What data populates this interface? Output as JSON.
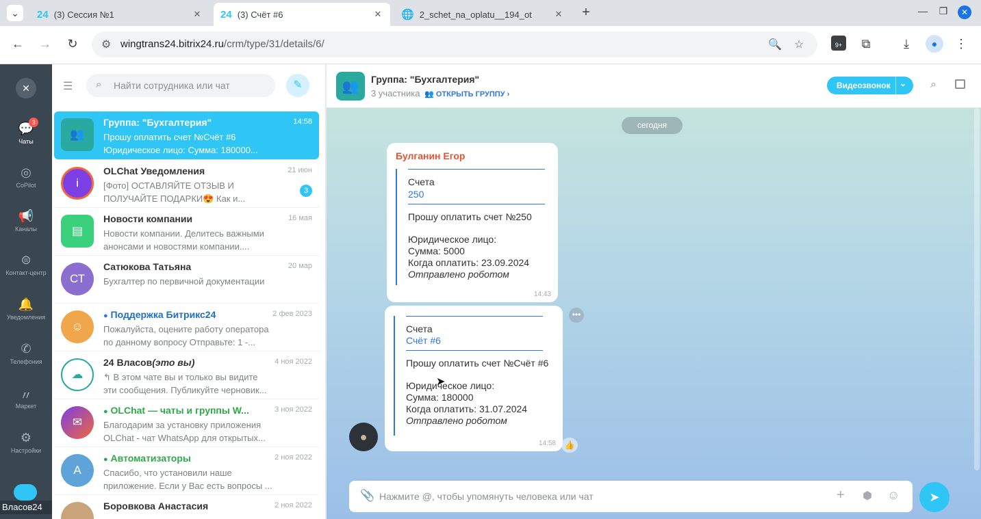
{
  "browser": {
    "tabs": [
      {
        "favicon": "24",
        "title": "(3) Сессия №1"
      },
      {
        "favicon": "24",
        "title": "(3) Счёт #6"
      },
      {
        "favicon": "globe-icon",
        "title": "2_schet_na_oplatu__194_ot"
      }
    ],
    "new_tab": "+",
    "url_host": "wingtrans24.bitrix24.ru",
    "url_path": "/crm/type/31/details/6/",
    "extensions_badge": "9+"
  },
  "leftnav": {
    "items": [
      {
        "label": "Чаты",
        "icon": "chat-icon",
        "badge": "3"
      },
      {
        "label": "CoPilot",
        "icon": "copilot-icon"
      },
      {
        "label": "Каналы",
        "icon": "megaphone-icon"
      },
      {
        "label": "Контакт-центр",
        "icon": "contact-center-icon"
      },
      {
        "label": "Уведомления",
        "icon": "bell-icon"
      },
      {
        "label": "Телефония",
        "icon": "phone-icon"
      },
      {
        "label": "Маркет",
        "icon": "market-icon"
      },
      {
        "label": "Настройки",
        "icon": "gear-icon"
      }
    ],
    "user_label": "Власов24"
  },
  "chatlist": {
    "search_placeholder": "Найти сотрудника или чат",
    "items": [
      {
        "name": "Группа: \"Бухгалтерия\"",
        "time": "14:58",
        "preview1": "Прошу оплатить счет №Счёт #6",
        "preview2": "Юридическое лицо: Сумма: 180000...",
        "avatar_color": "#29a9a0",
        "initials": ""
      },
      {
        "name": "OLChat Уведомления",
        "time": "21 июн",
        "preview1": "[Фото] ОСТАВЛЯЙТЕ ОТЗЫВ И",
        "preview2": "ПОЛУЧАЙТЕ ПОДАРКИ😍 Как и...",
        "unread": "3",
        "avatar_color": "#7b3fe4",
        "initials": "i"
      },
      {
        "name": "Новости компании",
        "time": "16 мая",
        "preview1": "Новости компании. Делитесь важными",
        "preview2": "анонсами и новостями компании....",
        "avatar_color": "#3bd17c",
        "initials": ""
      },
      {
        "name": "Сатюкова Татьяна",
        "time": "20 мар",
        "preview1": "Бухгалтер по первичной документации",
        "preview2": "",
        "avatar_color": "#8a6fd1",
        "initials": "СТ"
      },
      {
        "name": "Поддержка Битрикс24",
        "time": "2 фев 2023",
        "preview1": "Пожалуйста, оцените работу оператора",
        "preview2": "по данному вопросу Отправьте: 1 -...",
        "avatar_color": "#f0a64a",
        "initials": ""
      },
      {
        "name": "24 Власов",
        "name_suffix": "(это вы)",
        "time": "4 ноя 2022",
        "preview1": "↰ В этом чате вы и только вы видите",
        "preview2": "эти сообщения. Публикуйте черновик...",
        "avatar_color": "#ffffff",
        "initials": ""
      },
      {
        "name": "OLChat — чаты и группы W...",
        "time": "3 ноя 2022",
        "preview1": "Благодарим за установку приложения",
        "preview2": "OLChat - чат WhatsApp для открытых...",
        "avatar_color": "#e2466b",
        "initials": ""
      },
      {
        "name": "Автоматизаторы",
        "time": "2 ноя 2022",
        "preview1": "Спасибо, что установили наше",
        "preview2": "приложение. Если у Вас есть вопросы ...",
        "avatar_color": "#5fa4d8",
        "initials": "А"
      },
      {
        "name": "Боровкова Анастасия",
        "time": "2 ноя 2022",
        "preview1": "",
        "preview2": "",
        "avatar_color": "#c9a37a",
        "initials": ""
      }
    ]
  },
  "chat": {
    "title": "Группа: \"Бухгалтерия\"",
    "members": "3 участника",
    "open_group": "ОТКРЫТЬ ГРУППУ",
    "video_call": "Видеозвонок",
    "date_divider": "сегодня",
    "messages": [
      {
        "author": "Булганин Егор",
        "q_title": "Счета",
        "q_link": "250",
        "body": "Прошу оплатить счет №250",
        "l1": "Юридическое лицо:",
        "l2": "Сумма: 5000",
        "l3": "Когда оплатить: 23.09.2024",
        "l4": "Отправлено роботом",
        "time": "14:43"
      },
      {
        "author": "",
        "q_title": "Счета",
        "q_link": "Счёт #6",
        "body": "Прошу оплатить счет №Счёт #6",
        "l1": "Юридическое лицо:",
        "l2": "Сумма: 180000",
        "l3": "Когда оплатить: 31.07.2024",
        "l4": "Отправлено роботом",
        "time": "14:58"
      }
    ],
    "input_placeholder": "Нажмите @, чтобы упомянуть человека или чат"
  }
}
